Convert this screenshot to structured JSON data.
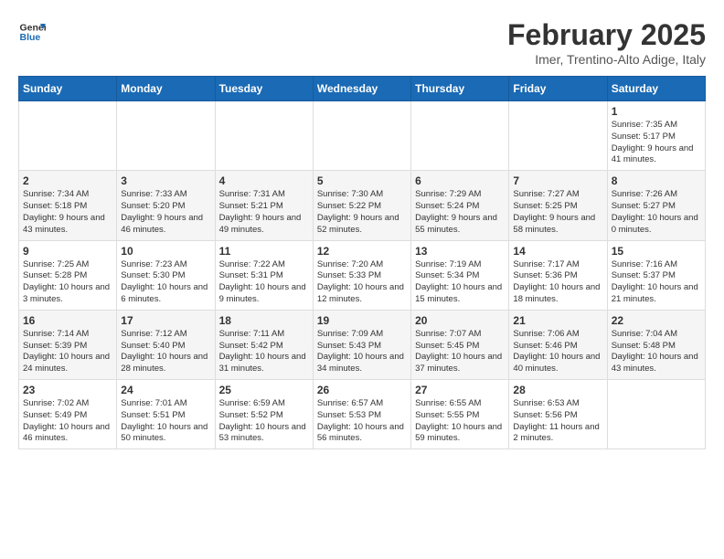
{
  "header": {
    "logo_line1": "General",
    "logo_line2": "Blue",
    "month_title": "February 2025",
    "subtitle": "Imer, Trentino-Alto Adige, Italy"
  },
  "days_of_week": [
    "Sunday",
    "Monday",
    "Tuesday",
    "Wednesday",
    "Thursday",
    "Friday",
    "Saturday"
  ],
  "weeks": [
    [
      {
        "day": "",
        "info": ""
      },
      {
        "day": "",
        "info": ""
      },
      {
        "day": "",
        "info": ""
      },
      {
        "day": "",
        "info": ""
      },
      {
        "day": "",
        "info": ""
      },
      {
        "day": "",
        "info": ""
      },
      {
        "day": "1",
        "info": "Sunrise: 7:35 AM\nSunset: 5:17 PM\nDaylight: 9 hours and 41 minutes."
      }
    ],
    [
      {
        "day": "2",
        "info": "Sunrise: 7:34 AM\nSunset: 5:18 PM\nDaylight: 9 hours and 43 minutes."
      },
      {
        "day": "3",
        "info": "Sunrise: 7:33 AM\nSunset: 5:20 PM\nDaylight: 9 hours and 46 minutes."
      },
      {
        "day": "4",
        "info": "Sunrise: 7:31 AM\nSunset: 5:21 PM\nDaylight: 9 hours and 49 minutes."
      },
      {
        "day": "5",
        "info": "Sunrise: 7:30 AM\nSunset: 5:22 PM\nDaylight: 9 hours and 52 minutes."
      },
      {
        "day": "6",
        "info": "Sunrise: 7:29 AM\nSunset: 5:24 PM\nDaylight: 9 hours and 55 minutes."
      },
      {
        "day": "7",
        "info": "Sunrise: 7:27 AM\nSunset: 5:25 PM\nDaylight: 9 hours and 58 minutes."
      },
      {
        "day": "8",
        "info": "Sunrise: 7:26 AM\nSunset: 5:27 PM\nDaylight: 10 hours and 0 minutes."
      }
    ],
    [
      {
        "day": "9",
        "info": "Sunrise: 7:25 AM\nSunset: 5:28 PM\nDaylight: 10 hours and 3 minutes."
      },
      {
        "day": "10",
        "info": "Sunrise: 7:23 AM\nSunset: 5:30 PM\nDaylight: 10 hours and 6 minutes."
      },
      {
        "day": "11",
        "info": "Sunrise: 7:22 AM\nSunset: 5:31 PM\nDaylight: 10 hours and 9 minutes."
      },
      {
        "day": "12",
        "info": "Sunrise: 7:20 AM\nSunset: 5:33 PM\nDaylight: 10 hours and 12 minutes."
      },
      {
        "day": "13",
        "info": "Sunrise: 7:19 AM\nSunset: 5:34 PM\nDaylight: 10 hours and 15 minutes."
      },
      {
        "day": "14",
        "info": "Sunrise: 7:17 AM\nSunset: 5:36 PM\nDaylight: 10 hours and 18 minutes."
      },
      {
        "day": "15",
        "info": "Sunrise: 7:16 AM\nSunset: 5:37 PM\nDaylight: 10 hours and 21 minutes."
      }
    ],
    [
      {
        "day": "16",
        "info": "Sunrise: 7:14 AM\nSunset: 5:39 PM\nDaylight: 10 hours and 24 minutes."
      },
      {
        "day": "17",
        "info": "Sunrise: 7:12 AM\nSunset: 5:40 PM\nDaylight: 10 hours and 28 minutes."
      },
      {
        "day": "18",
        "info": "Sunrise: 7:11 AM\nSunset: 5:42 PM\nDaylight: 10 hours and 31 minutes."
      },
      {
        "day": "19",
        "info": "Sunrise: 7:09 AM\nSunset: 5:43 PM\nDaylight: 10 hours and 34 minutes."
      },
      {
        "day": "20",
        "info": "Sunrise: 7:07 AM\nSunset: 5:45 PM\nDaylight: 10 hours and 37 minutes."
      },
      {
        "day": "21",
        "info": "Sunrise: 7:06 AM\nSunset: 5:46 PM\nDaylight: 10 hours and 40 minutes."
      },
      {
        "day": "22",
        "info": "Sunrise: 7:04 AM\nSunset: 5:48 PM\nDaylight: 10 hours and 43 minutes."
      }
    ],
    [
      {
        "day": "23",
        "info": "Sunrise: 7:02 AM\nSunset: 5:49 PM\nDaylight: 10 hours and 46 minutes."
      },
      {
        "day": "24",
        "info": "Sunrise: 7:01 AM\nSunset: 5:51 PM\nDaylight: 10 hours and 50 minutes."
      },
      {
        "day": "25",
        "info": "Sunrise: 6:59 AM\nSunset: 5:52 PM\nDaylight: 10 hours and 53 minutes."
      },
      {
        "day": "26",
        "info": "Sunrise: 6:57 AM\nSunset: 5:53 PM\nDaylight: 10 hours and 56 minutes."
      },
      {
        "day": "27",
        "info": "Sunrise: 6:55 AM\nSunset: 5:55 PM\nDaylight: 10 hours and 59 minutes."
      },
      {
        "day": "28",
        "info": "Sunrise: 6:53 AM\nSunset: 5:56 PM\nDaylight: 11 hours and 2 minutes."
      },
      {
        "day": "",
        "info": ""
      }
    ]
  ]
}
